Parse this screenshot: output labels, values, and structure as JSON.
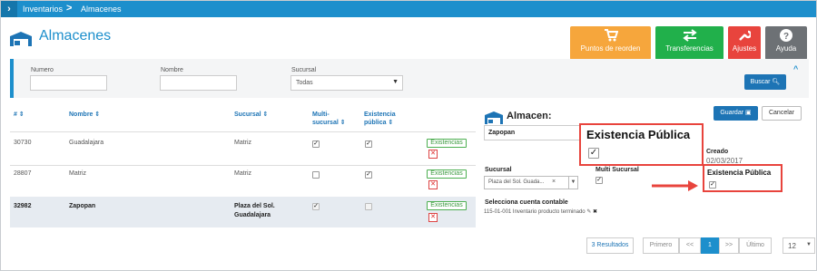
{
  "breadcrumb": {
    "items": [
      "Inventarios",
      "Almacenes"
    ],
    "separator": ">"
  },
  "header": {
    "title": "Almacenes",
    "buttons": [
      {
        "label": "Puntos de reorden",
        "icon": "cart-icon",
        "color": "#f6a63c"
      },
      {
        "label": "Transferencias",
        "icon": "swap-arrows-icon",
        "color": "#21b04b"
      },
      {
        "label": "Ajustes",
        "icon": "wrench-icon",
        "color": "#e8443d"
      },
      {
        "label": "Ayuda",
        "icon": "question-icon",
        "color": "#6d7175"
      }
    ]
  },
  "filter": {
    "numero_label": "Numero",
    "numero_value": "",
    "nombre_label": "Nombre",
    "nombre_value": "",
    "sucursal_label": "Sucursal",
    "sucursal_value": "Todas",
    "buscar_label": "Buscar"
  },
  "table": {
    "headers": {
      "numero": "#",
      "nombre": "Nombre",
      "sucursal": "Sucursal",
      "multi1": "Multi-",
      "multi2": "sucursal",
      "existencia1": "Existencia",
      "existencia2": "pública"
    },
    "rows": [
      {
        "numero": "30730",
        "nombre": "Guadalajara",
        "sucursal": "Matriz",
        "sucursal2": "",
        "multi": true,
        "existencia": true,
        "action": "Existencias",
        "selected": false
      },
      {
        "numero": "28807",
        "nombre": "Matriz",
        "sucursal": "Matriz",
        "sucursal2": "",
        "multi": false,
        "existencia": true,
        "action": "Existencias",
        "selected": false
      },
      {
        "numero": "32982",
        "nombre": "Zapopan",
        "sucursal": "Plaza del Sol.",
        "sucursal2": "Guadalajara",
        "multi": true,
        "existencia": false,
        "action": "Existencias",
        "selected": true
      }
    ]
  },
  "detail": {
    "title": "Almacen:",
    "guardar_label": "Guardar",
    "cancelar_label": "Cancelar",
    "name_value": "Zapopan",
    "creado_label": "Creado",
    "creado_value": "02/03/2017",
    "sucursal_label": "Sucursal",
    "sucursal_value": "Plaza del Sol. Guada...",
    "multi_label": "Multi Sucursal",
    "existencia_label": "Existencia Pública",
    "cuenta_label": "Selecciona cuenta contable",
    "cuenta_value": "115-01-001 Inventario producto terminado"
  },
  "callout": {
    "title": "Existencia Pública",
    "color": "#e8443d"
  },
  "pagination": {
    "info": "3 Resultados",
    "first": "Primero",
    "prev": "<<",
    "page": "1",
    "next": ">>",
    "last": "Último",
    "per_page": "12"
  },
  "colors": {
    "accent": "#1d8fcc",
    "primary_button": "#1d74b5",
    "success": "#3a9a3e",
    "danger": "#e8443d"
  }
}
